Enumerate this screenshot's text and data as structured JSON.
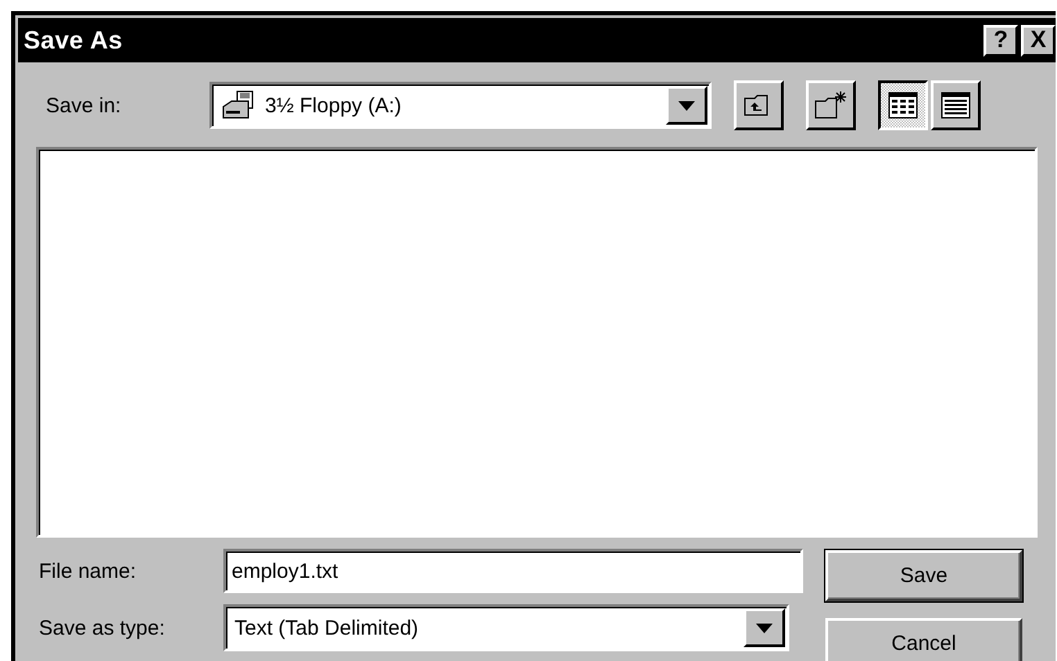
{
  "window": {
    "title": "Save As",
    "title_buttons": [
      {
        "label": "?"
      },
      {
        "label": "X"
      }
    ]
  },
  "save_in": {
    "label": "Save in:",
    "value": "3½ Floppy (A:)"
  },
  "toolbar": [
    {
      "kind": "up-folder",
      "selected": false
    },
    {
      "kind": "new-folder",
      "selected": false
    },
    {
      "kind": "list-view",
      "selected": true
    },
    {
      "kind": "details-view",
      "selected": false
    }
  ],
  "file_name": {
    "label": "File name:",
    "value": "employ1.txt"
  },
  "save_as_type": {
    "label": "Save as type:",
    "value": "Text (Tab Delimited)"
  },
  "buttons": [
    {
      "label": "Save",
      "default": true
    },
    {
      "label": "Cancel",
      "default": false
    }
  ]
}
